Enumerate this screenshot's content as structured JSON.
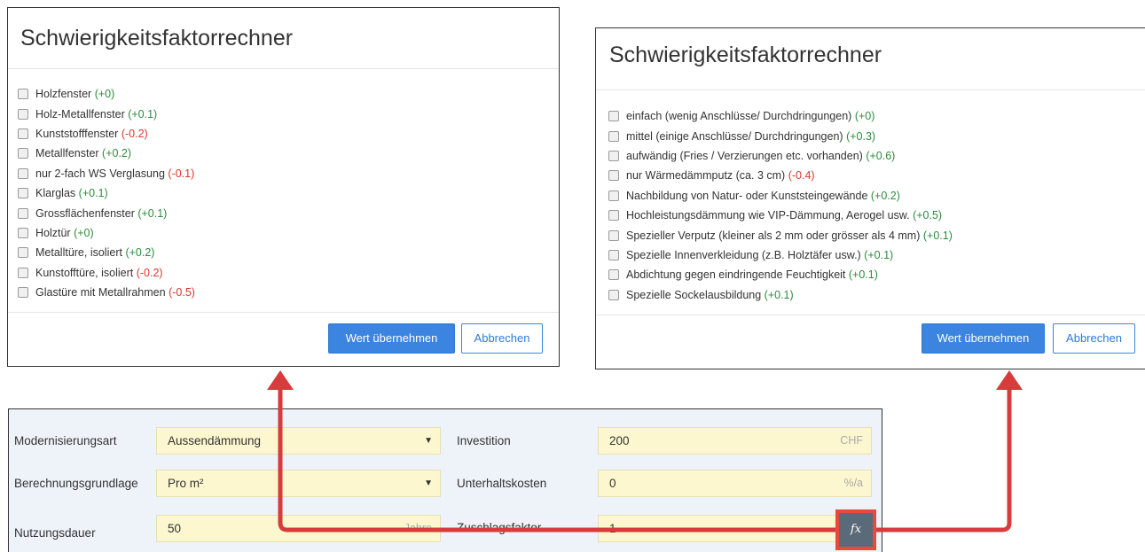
{
  "left_dialog": {
    "title": "Schwierigkeitsfaktorrechner",
    "options": [
      {
        "label": "Holzfenster",
        "value": "(+0)",
        "tone": "pos"
      },
      {
        "label": "Holz-Metallfenster",
        "value": "(+0.1)",
        "tone": "pos"
      },
      {
        "label": "Kunststofffenster",
        "value": "(-0.2)",
        "tone": "neg"
      },
      {
        "label": "Metallfenster",
        "value": "(+0.2)",
        "tone": "pos"
      },
      {
        "label": "nur 2-fach WS Verglasung",
        "value": "(-0.1)",
        "tone": "neg"
      },
      {
        "label": "Klarglas",
        "value": "(+0.1)",
        "tone": "pos"
      },
      {
        "label": "Grossflächenfenster",
        "value": "(+0.1)",
        "tone": "pos"
      },
      {
        "label": "Holztür",
        "value": "(+0)",
        "tone": "pos"
      },
      {
        "label": "Metalltüre, isoliert",
        "value": "(+0.2)",
        "tone": "pos"
      },
      {
        "label": "Kunstofftüre, isoliert",
        "value": "(-0.2)",
        "tone": "neg"
      },
      {
        "label": "Glastüre mit Metallrahmen",
        "value": "(-0.5)",
        "tone": "neg"
      }
    ],
    "apply_label": "Wert übernehmen",
    "cancel_label": "Abbrechen"
  },
  "right_dialog": {
    "title": "Schwierigkeitsfaktorrechner",
    "options": [
      {
        "label": "einfach (wenig Anschlüsse/ Durchdringungen)",
        "value": "(+0)",
        "tone": "pos"
      },
      {
        "label": "mittel (einige Anschlüsse/ Durchdringungen)",
        "value": "(+0.3)",
        "tone": "pos"
      },
      {
        "label": "aufwändig (Fries / Verzierungen etc. vorhanden)",
        "value": "(+0.6)",
        "tone": "pos"
      },
      {
        "label": "nur Wärmedämmputz (ca. 3 cm)",
        "value": "(-0.4)",
        "tone": "neg"
      },
      {
        "label": "Nachbildung von Natur- oder Kunststeingewände",
        "value": "(+0.2)",
        "tone": "pos"
      },
      {
        "label": "Hochleistungsdämmung wie VIP-Dämmung, Aerogel usw.",
        "value": "(+0.5)",
        "tone": "pos"
      },
      {
        "label": "Spezieller Verputz (kleiner als 2 mm oder grösser als 4 mm)",
        "value": "(+0.1)",
        "tone": "pos"
      },
      {
        "label": "Spezielle Innenverkleidung (z.B. Holztäfer usw.)",
        "value": "(+0.1)",
        "tone": "pos"
      },
      {
        "label": "Abdichtung gegen eindringende Feuchtigkeit",
        "value": "(+0.1)",
        "tone": "pos"
      },
      {
        "label": "Spezielle Sockelausbildung",
        "value": "(+0.1)",
        "tone": "pos"
      }
    ],
    "apply_label": "Wert übernehmen",
    "cancel_label": "Abbrechen"
  },
  "form": {
    "modernisierungsart": {
      "label": "Modernisierungsart",
      "value": "Aussendämmung"
    },
    "berechnungsgrundlage": {
      "label": "Berechnungsgrundlage",
      "value": "Pro m²"
    },
    "nutzungsdauer": {
      "label": "Nutzungsdauer",
      "value": "50",
      "unit": "Jahre"
    },
    "investition": {
      "label": "Investition",
      "value": "200",
      "unit": "CHF"
    },
    "unterhaltskosten": {
      "label": "Unterhaltskosten",
      "value": "0",
      "unit": "%/a"
    },
    "zuschlagsfaktor": {
      "label": "Zuschlagsfaktor",
      "value": "1"
    },
    "fx_label": "fx"
  },
  "colors": {
    "positive": "#2e8b3e",
    "negative": "#d9372b",
    "primary": "#3b85e0",
    "highlight": "#e74a3b",
    "field_bg": "#fdf7cf"
  }
}
